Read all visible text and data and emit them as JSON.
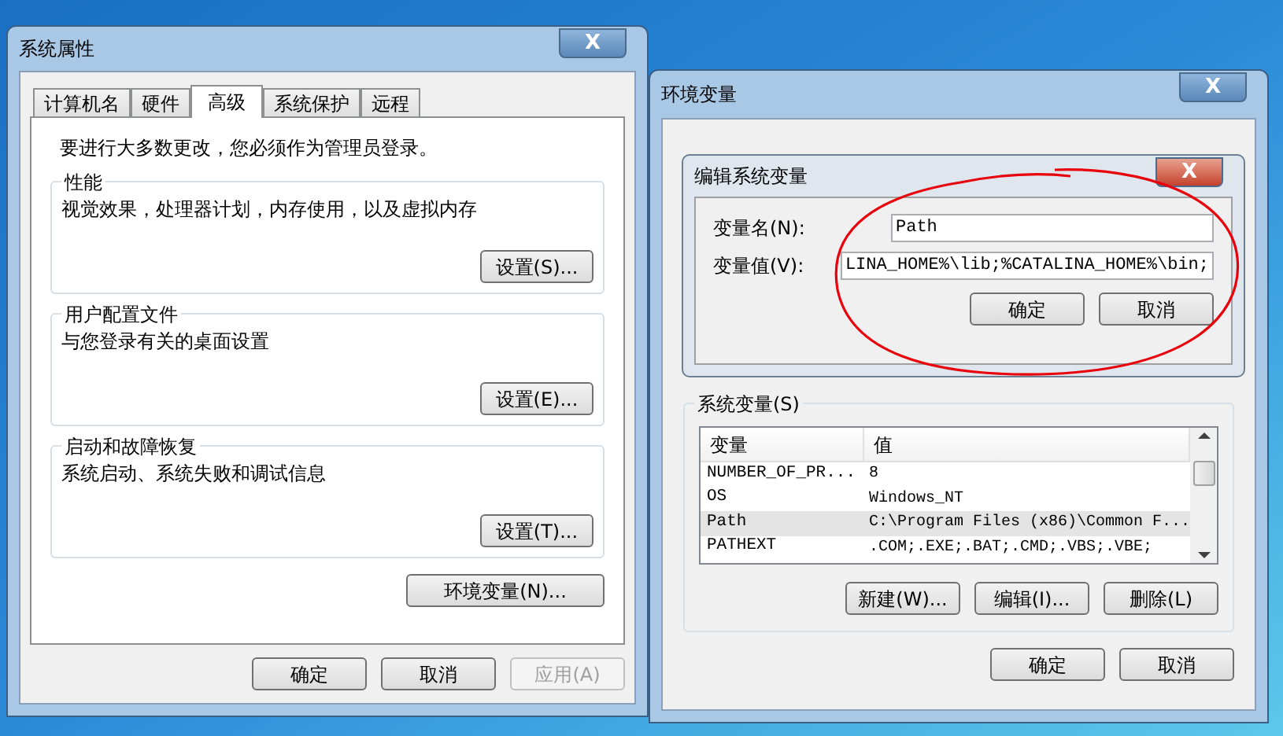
{
  "system_properties": {
    "title": "系统属性",
    "close": "X",
    "tabs": [
      {
        "label": "计算机名",
        "selected": false
      },
      {
        "label": "硬件",
        "selected": false
      },
      {
        "label": "高级",
        "selected": true
      },
      {
        "label": "系统保护",
        "selected": false
      },
      {
        "label": "远程",
        "selected": false
      }
    ],
    "notice": "要进行大多数更改，您必须作为管理员登录。",
    "groups": [
      {
        "title": "性能",
        "description": "视觉效果，处理器计划，内存使用，以及虚拟内存",
        "button": "设置(S)..."
      },
      {
        "title": "用户配置文件",
        "description": "与您登录有关的桌面设置",
        "button": "设置(E)..."
      },
      {
        "title": "启动和故障恢复",
        "description": "系统启动、系统失败和调试信息",
        "button": "设置(T)..."
      }
    ],
    "env_button": "环境变量(N)...",
    "buttons": [
      {
        "label": "确定",
        "disabled": false
      },
      {
        "label": "取消",
        "disabled": false
      },
      {
        "label": "应用(A)",
        "disabled": true
      }
    ]
  },
  "environment_variables": {
    "title": "环境变量",
    "close": "X",
    "system_group": "系统变量(S)",
    "columns": [
      "变量",
      "值"
    ],
    "rows": [
      {
        "name": "NUMBER_OF_PR...",
        "value": "8",
        "selected": false
      },
      {
        "name": "OS",
        "value": "Windows_NT",
        "selected": false
      },
      {
        "name": "Path",
        "value": "C:\\Program Files (x86)\\Common F...",
        "selected": true
      },
      {
        "name": "PATHEXT",
        "value": ".COM;.EXE;.BAT;.CMD;.VBS;.VBE;",
        "selected": false
      }
    ],
    "list_buttons": [
      "新建(W)...",
      "编辑(I)...",
      "删除(L)"
    ],
    "buttons": [
      "确定",
      "取消"
    ]
  },
  "edit_dialog": {
    "title": "编辑系统变量",
    "close": "X",
    "fields": [
      {
        "label": "变量名(N):",
        "value": "Path"
      },
      {
        "label": "变量值(V):",
        "value": "LINA_HOME%\\lib;%CATALINA_HOME%\\bin;"
      }
    ],
    "buttons": [
      "确定",
      "取消"
    ]
  }
}
